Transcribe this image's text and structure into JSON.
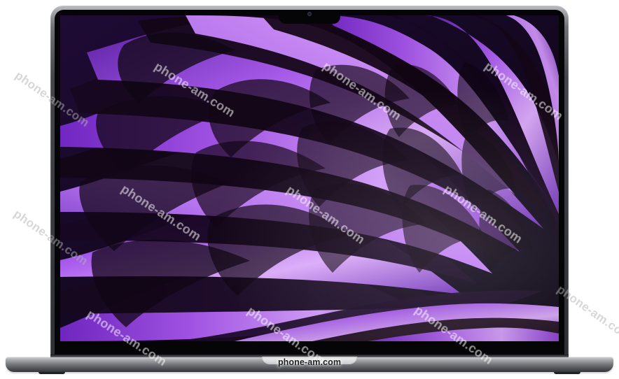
{
  "image": {
    "subject": "laptop-display",
    "colors": {
      "background": "#ffffff",
      "laptop_silver": "#a8aaae",
      "bezel": "#050507",
      "wallpaper_dark": "#140921",
      "wallpaper_violet": "#7a3fc8",
      "wallpaper_lilac": "#d19af8"
    }
  },
  "watermarks": [
    "phone-am.com",
    "phone-am.com",
    "phone-am.com",
    "phone-am.com",
    "phone-am.com",
    "phone-am.com",
    "phone-am.com",
    "phone-am.com",
    "phone-am.com",
    "phone-am.com",
    "phone-am.com",
    "phone-am.com"
  ],
  "website": "phone-am.com"
}
